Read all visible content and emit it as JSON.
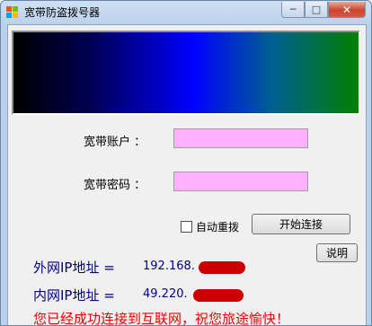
{
  "window": {
    "title": "宽带防盗拨号器",
    "minimize_glyph": "─",
    "maximize_glyph": "□",
    "close_glyph": "✕"
  },
  "form": {
    "account_label": "宽带账户 ：",
    "account_value": "",
    "password_label": "宽带密码 ：",
    "password_value": ""
  },
  "controls": {
    "auto_redial_label": "自动重拨",
    "auto_redial_checked": false,
    "connect_button": "开始连接",
    "help_button": "说明"
  },
  "network": {
    "external_ip_label": "外网IP地址 =",
    "external_ip_value": "192.168.",
    "internal_ip_label": "内网IP地址 =",
    "internal_ip_value": "49.220."
  },
  "status_message": "您已经成功连接到互联网，祝您旅途愉快！",
  "colors": {
    "ip_text": "#000080",
    "status_text": "#ee0000",
    "input_background": "#ffb0ff",
    "redaction": "#cc0000"
  }
}
